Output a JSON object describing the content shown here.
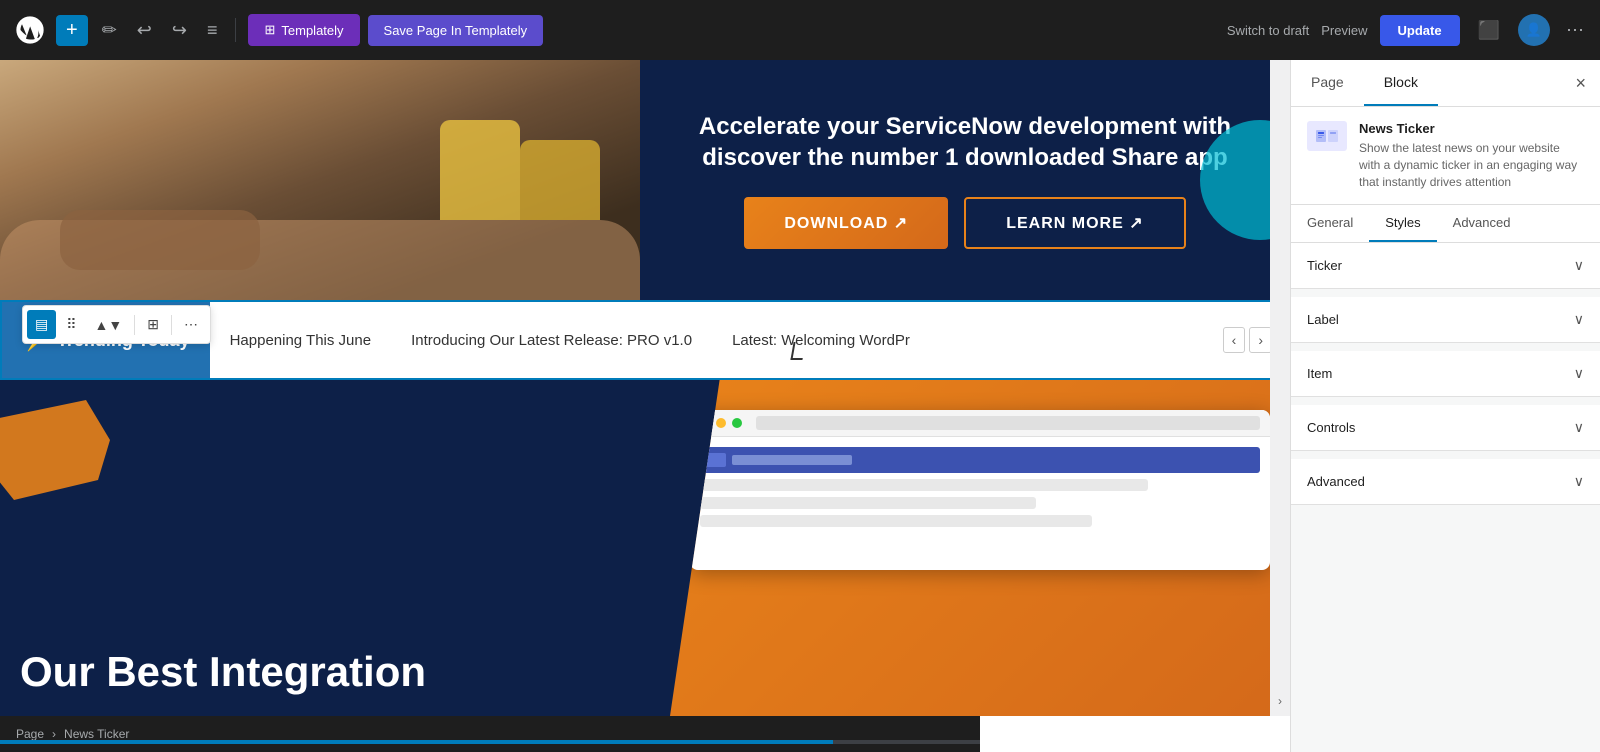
{
  "toolbar": {
    "wp_logo_label": "WordPress",
    "add_label": "+",
    "pen_label": "✏",
    "undo_label": "↩",
    "redo_label": "↪",
    "list_label": "≡",
    "templately_label": "Templately",
    "save_templately_label": "Save Page In Templately",
    "switch_draft_label": "Switch to draft",
    "preview_label": "Preview",
    "update_label": "Update"
  },
  "hero": {
    "text": "Accelerate your ServiceNow development with discover the number 1 downloaded Share app",
    "download_label": "DOWNLOAD ↗",
    "learn_more_label": "LEARN MORE ↗"
  },
  "block_toolbar": {
    "tools": [
      "▤",
      "⠿",
      "▲▼",
      "⊞",
      "⋯"
    ]
  },
  "ticker": {
    "label": "Trending Today",
    "items": [
      "Happening This June",
      "Introducing Our Latest Release: PRO v1.0",
      "Latest: Welcoming WordPr"
    ]
  },
  "bottom": {
    "heading": "Our Best Integration"
  },
  "breadcrumb": {
    "page": "Page",
    "separator": "›",
    "current": "News Ticker"
  },
  "right_panel": {
    "tab_page": "Page",
    "tab_block": "Block",
    "close_label": "×",
    "block_title": "News Ticker",
    "block_desc": "Show the latest news on your website with a dynamic ticker in an engaging way that instantly drives attention",
    "sub_tabs": [
      "General",
      "Styles",
      "Advanced"
    ],
    "active_sub_tab": "Styles",
    "sections": [
      {
        "title": "Ticker",
        "expanded": false
      },
      {
        "title": "Label",
        "expanded": false
      },
      {
        "title": "Item",
        "expanded": false
      },
      {
        "title": "Controls",
        "expanded": false
      },
      {
        "title": "Advanced",
        "expanded": false
      }
    ]
  }
}
